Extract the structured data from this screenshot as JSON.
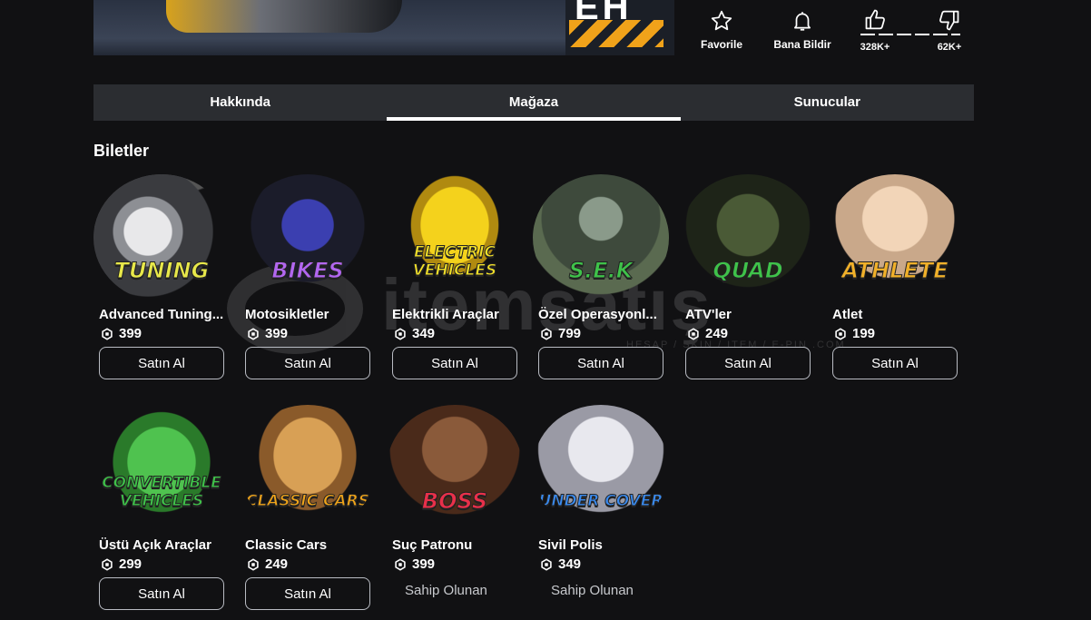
{
  "banner": {
    "sign_text": "EH"
  },
  "actions": {
    "favorite_label": "Favorile",
    "report_label": "Bana Bildir",
    "likes": "328K+",
    "dislikes": "62K+"
  },
  "tabs": [
    {
      "label": "Hakkında",
      "active": false
    },
    {
      "label": "Mağaza",
      "active": true
    },
    {
      "label": "Sunucular",
      "active": false
    }
  ],
  "section": {
    "title": "Biletler"
  },
  "passes": [
    {
      "name": "Advanced Tuning...",
      "price": "399",
      "badge": "TUNING",
      "badge_color": "#e8e84a",
      "action": "Satın Al",
      "owned": false
    },
    {
      "name": "Motosikletler",
      "price": "399",
      "badge": "BIKES",
      "badge_color": "#b267f0",
      "action": "Satın Al",
      "owned": false
    },
    {
      "name": "Elektrikli Araçlar",
      "price": "349",
      "badge": "ELECTRIC VEHICLES",
      "badge_color": "#f2e12a",
      "action": "Satın Al",
      "owned": false
    },
    {
      "name": "Özel Operasyonl...",
      "price": "799",
      "badge": "S.E.K",
      "badge_color": "#3fc24a",
      "action": "Satın Al",
      "owned": false
    },
    {
      "name": "ATV'ler",
      "price": "249",
      "badge": "QUAD",
      "badge_color": "#3fc24a",
      "action": "Satın Al",
      "owned": false
    },
    {
      "name": "Atlet",
      "price": "199",
      "badge": "ATHLETE",
      "badge_color": "#f0b02a",
      "action": "Satın Al",
      "owned": false
    },
    {
      "name": "Üstü Açık Araçlar",
      "price": "299",
      "badge": "CONVERTIBLE VEHICLES",
      "badge_color": "#3fc24a",
      "action": "Satın Al",
      "owned": false
    },
    {
      "name": "Classic Cars",
      "price": "249",
      "badge": "CLASSIC CARS",
      "badge_color": "#f0a41a",
      "action": "Satın Al",
      "owned": false
    },
    {
      "name": "Suç Patronu",
      "price": "399",
      "badge": "BOSS",
      "badge_color": "#e8304a",
      "action": "Sahip Olunan",
      "owned": true
    },
    {
      "name": "Sivil Polis",
      "price": "349",
      "badge": "UNDER COVER",
      "badge_color": "#3a8bf0",
      "action": "Sahip Olunan",
      "owned": true
    }
  ],
  "watermark": {
    "brand": "itemsatış",
    "tagline": "HESAP / SKIN / ITEM / E-PIN .COM"
  }
}
